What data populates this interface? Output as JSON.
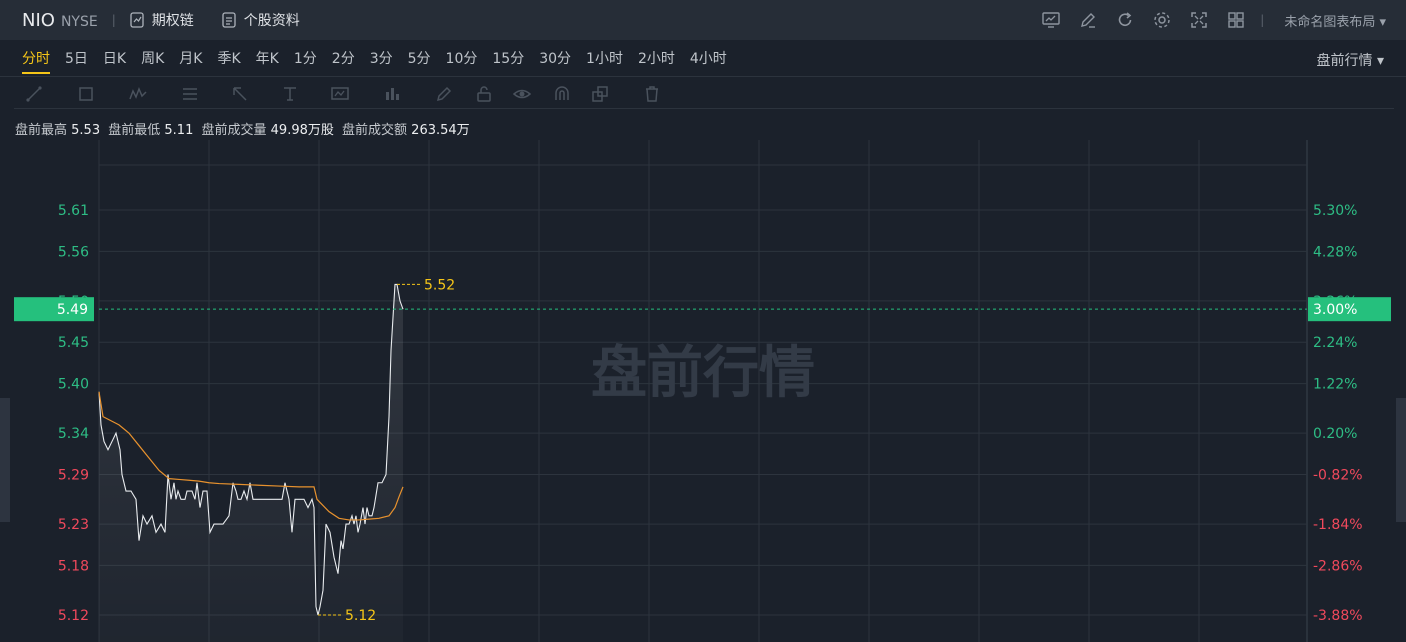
{
  "header": {
    "symbol": "NIO",
    "exchange": "NYSE",
    "options_chain": "期权链",
    "profile": "个股资料",
    "layout_name": "未命名图表布局 ▾",
    "tools": [
      "chart-monitor-icon",
      "edit-icon",
      "refresh-icon",
      "settings-icon",
      "fullscreen-icon",
      "grid-layout-icon"
    ]
  },
  "periods": [
    "分时",
    "5日",
    "日K",
    "周K",
    "月K",
    "季K",
    "年K",
    "1分",
    "2分",
    "3分",
    "5分",
    "10分",
    "15分",
    "30分",
    "1小时",
    "2小时",
    "4小时"
  ],
  "active_period": "分时",
  "session_label": "盘前行情 ▾",
  "drawing_tools": [
    "line-tool-icon",
    "rectangle-tool-icon",
    "pattern-tool-icon",
    "fib-tool-icon",
    "arrow-tool-icon",
    "text-tool-icon",
    "measure-tool-icon",
    "indicator-icon",
    "pencil-icon",
    "lock-icon",
    "eye-icon",
    "magnet-icon",
    "layers-icon",
    "trash-icon"
  ],
  "stats": {
    "high_label": "盘前最高",
    "high": "5.53",
    "low_label": "盘前最低",
    "low": "5.11",
    "volume_label": "盘前成交量",
    "volume": "49.98万股",
    "turnover_label": "盘前成交额",
    "turnover": "263.54万"
  },
  "colors": {
    "up": "#2ebd85",
    "down": "#f0495c",
    "price_line": "#e9ecef",
    "avg_line": "#e8922e",
    "highlight": "#f5c518",
    "current_badge": "#25c07d",
    "watermark": "#333b47"
  },
  "chart_data": {
    "type": "line",
    "watermark": "盘前行情",
    "current_price": "5.49",
    "current_pct": "3.00%",
    "y_ticks_left": [
      "5.61",
      "5.56",
      "5.50",
      "5.45",
      "5.40",
      "5.34",
      "5.29",
      "5.23",
      "5.18",
      "5.12"
    ],
    "y_ticks_right": [
      "5.30%",
      "4.28%",
      "3.26%",
      "2.24%",
      "1.22%",
      "0.20%",
      "-0.82%",
      "-1.84%",
      "-2.86%",
      "-3.88%"
    ],
    "y_tick_values": [
      5.61,
      5.56,
      5.5,
      5.45,
      5.4,
      5.34,
      5.29,
      5.23,
      5.18,
      5.12
    ],
    "ylim": [
      5.09,
      5.67
    ],
    "x_count": 314,
    "price": [
      [
        0,
        5.39
      ],
      [
        2,
        5.35
      ],
      [
        5,
        5.33
      ],
      [
        9,
        5.32
      ],
      [
        13,
        5.33
      ],
      [
        17,
        5.34
      ],
      [
        21,
        5.32
      ],
      [
        23,
        5.29
      ],
      [
        27,
        5.27
      ],
      [
        32,
        5.27
      ],
      [
        37,
        5.26
      ],
      [
        40,
        5.21
      ],
      [
        44,
        5.24
      ],
      [
        48,
        5.23
      ],
      [
        53,
        5.24
      ],
      [
        57,
        5.22
      ],
      [
        62,
        5.23
      ],
      [
        66,
        5.22
      ],
      [
        69,
        5.29
      ],
      [
        72,
        5.26
      ],
      [
        75,
        5.28
      ],
      [
        77,
        5.26
      ],
      [
        79,
        5.27
      ],
      [
        82,
        5.26
      ],
      [
        86,
        5.26
      ],
      [
        88,
        5.27
      ],
      [
        93,
        5.27
      ],
      [
        96,
        5.26
      ],
      [
        98,
        5.28
      ],
      [
        101,
        5.25
      ],
      [
        104,
        5.27
      ],
      [
        108,
        5.27
      ],
      [
        111,
        5.22
      ],
      [
        115,
        5.23
      ],
      [
        124,
        5.23
      ],
      [
        130,
        5.24
      ],
      [
        134,
        5.28
      ],
      [
        137,
        5.27
      ],
      [
        139,
        5.26
      ],
      [
        142,
        5.26
      ],
      [
        145,
        5.27
      ],
      [
        148,
        5.26
      ],
      [
        151,
        5.28
      ],
      [
        154,
        5.26
      ],
      [
        158,
        5.26
      ],
      [
        165,
        5.26
      ],
      [
        172,
        5.26
      ],
      [
        178,
        5.26
      ],
      [
        183,
        5.26
      ],
      [
        186,
        5.28
      ],
      [
        190,
        5.26
      ],
      [
        193,
        5.22
      ],
      [
        196,
        5.26
      ],
      [
        200,
        5.26
      ],
      [
        205,
        5.26
      ],
      [
        209,
        5.25
      ],
      [
        213,
        5.26
      ],
      [
        215,
        5.25
      ],
      [
        217,
        5.13
      ],
      [
        219,
        5.12
      ],
      [
        221,
        5.13
      ],
      [
        224,
        5.15
      ],
      [
        227,
        5.23
      ],
      [
        231,
        5.22
      ],
      [
        235,
        5.19
      ],
      [
        239,
        5.17
      ],
      [
        242,
        5.21
      ],
      [
        244,
        5.2
      ],
      [
        247,
        5.23
      ],
      [
        250,
        5.23
      ],
      [
        253,
        5.24
      ],
      [
        255,
        5.23
      ],
      [
        257,
        5.24
      ],
      [
        259,
        5.22
      ],
      [
        261,
        5.23
      ],
      [
        264,
        5.25
      ],
      [
        266,
        5.23
      ],
      [
        268,
        5.25
      ],
      [
        270,
        5.24
      ],
      [
        273,
        5.24
      ],
      [
        275,
        5.25
      ],
      [
        279,
        5.28
      ],
      [
        283,
        5.28
      ],
      [
        287,
        5.29
      ],
      [
        290,
        5.36
      ],
      [
        292,
        5.44
      ],
      [
        294,
        5.48
      ],
      [
        296,
        5.52
      ],
      [
        298,
        5.52
      ],
      [
        301,
        5.5
      ],
      [
        304,
        5.49
      ]
    ],
    "avg": [
      [
        0,
        5.39
      ],
      [
        4,
        5.36
      ],
      [
        12,
        5.355
      ],
      [
        20,
        5.35
      ],
      [
        30,
        5.34
      ],
      [
        40,
        5.325
      ],
      [
        50,
        5.31
      ],
      [
        60,
        5.295
      ],
      [
        70,
        5.285
      ],
      [
        80,
        5.284
      ],
      [
        90,
        5.283
      ],
      [
        100,
        5.282
      ],
      [
        110,
        5.28
      ],
      [
        120,
        5.279
      ],
      [
        140,
        5.278
      ],
      [
        160,
        5.277
      ],
      [
        180,
        5.276
      ],
      [
        200,
        5.275
      ],
      [
        210,
        5.275
      ],
      [
        215,
        5.275
      ],
      [
        218,
        5.26
      ],
      [
        222,
        5.255
      ],
      [
        230,
        5.245
      ],
      [
        240,
        5.237
      ],
      [
        250,
        5.235
      ],
      [
        260,
        5.235
      ],
      [
        270,
        5.236
      ],
      [
        280,
        5.237
      ],
      [
        290,
        5.24
      ],
      [
        296,
        5.25
      ],
      [
        300,
        5.263
      ],
      [
        304,
        5.275
      ]
    ],
    "high_marker": {
      "index": 298,
      "label": "5.52"
    },
    "low_marker": {
      "index": 219,
      "label": "5.12"
    },
    "grid": true,
    "legend": "none"
  }
}
